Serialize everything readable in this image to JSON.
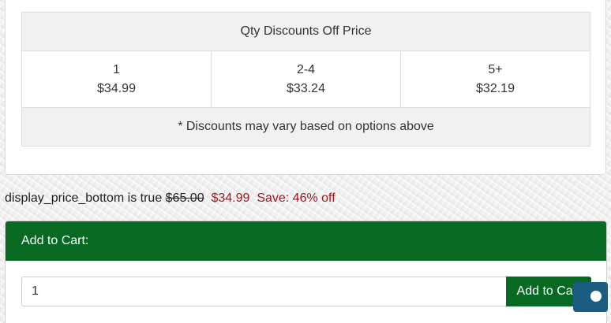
{
  "qty_discounts": {
    "heading": "Qty Discounts Off Price",
    "tiers": [
      {
        "qty": "1",
        "price": "$34.99"
      },
      {
        "qty": "2-4",
        "price": "$33.24"
      },
      {
        "qty": "5+",
        "price": "$32.19"
      }
    ],
    "note": "* Discounts may vary based on options above"
  },
  "price_display": {
    "label": "display_price_bottom is true ",
    "old_price": "$65.00",
    "new_price": "$34.99",
    "save_text": "Save: 46% off"
  },
  "cart": {
    "header": "Add to Cart:",
    "quantity_value": "1",
    "button_label": "Add to Cart"
  },
  "colors": {
    "brand_green": "#086a22",
    "sale_red": "#a5141b",
    "chat_blue": "#1b5d80"
  },
  "icons": {
    "chat_widget": "chat-bubble-icon"
  }
}
